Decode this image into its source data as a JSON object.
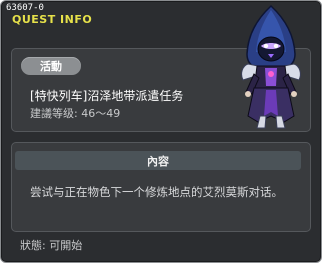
{
  "window": {
    "quest_id": "63607-0",
    "header_label": "QUEST INFO"
  },
  "quest": {
    "tag": "活動",
    "title": "[特快列车]沼泽地带派遣任务",
    "level_text": "建議等级: 46～49"
  },
  "content": {
    "header": "內容",
    "text": "尝试与正在物色下一个修炼地点的艾烈莫斯对话。"
  },
  "status": {
    "text": "狀態:  可開始"
  },
  "npc": {
    "icon": "hooded-character-portrait"
  },
  "colors": {
    "background": "#2b2d30",
    "panel": "#393b3e",
    "header_label": "#e6e14a",
    "tag": "#8c8f92",
    "content_bar": "#4b5358"
  }
}
